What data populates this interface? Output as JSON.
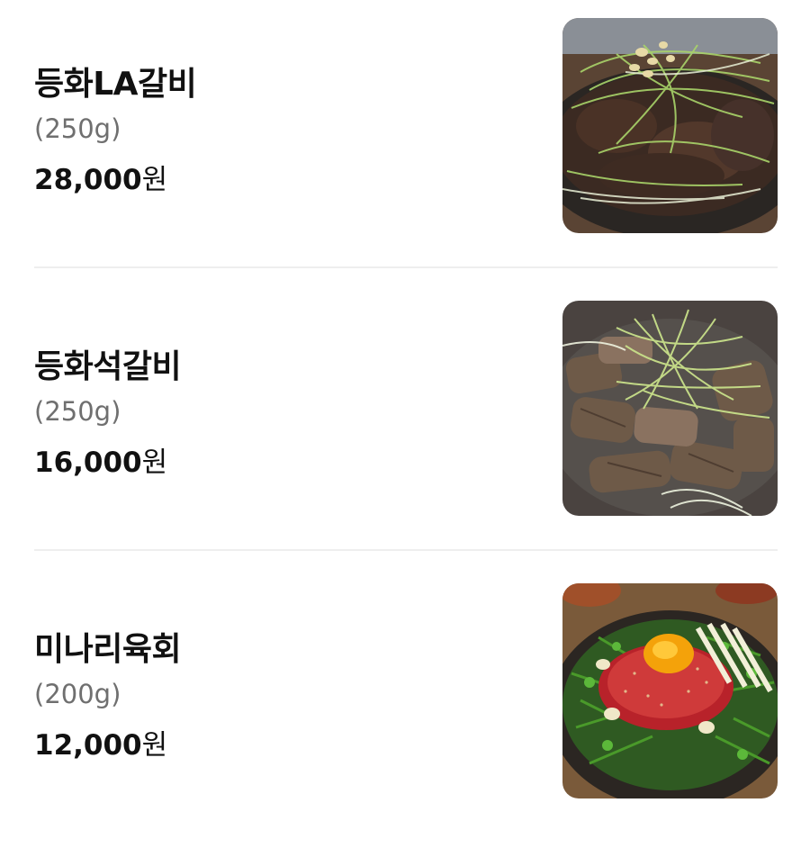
{
  "menu": {
    "items": [
      {
        "name": "등화LA갈비",
        "weight": "(250g)",
        "price": "28,000",
        "currency": "원",
        "image_icon": "la-galbi-photo"
      },
      {
        "name": "등화석갈비",
        "weight": "(250g)",
        "price": "16,000",
        "currency": "원",
        "image_icon": "stone-galbi-photo"
      },
      {
        "name": "미나리육회",
        "weight": "(200g)",
        "price": "12,000",
        "currency": "원",
        "image_icon": "minari-yukhoe-photo"
      }
    ]
  },
  "colors": {
    "text": "#111111",
    "secondary_text": "#6f6f6f",
    "divider": "#eeeeee",
    "background": "#ffffff"
  }
}
